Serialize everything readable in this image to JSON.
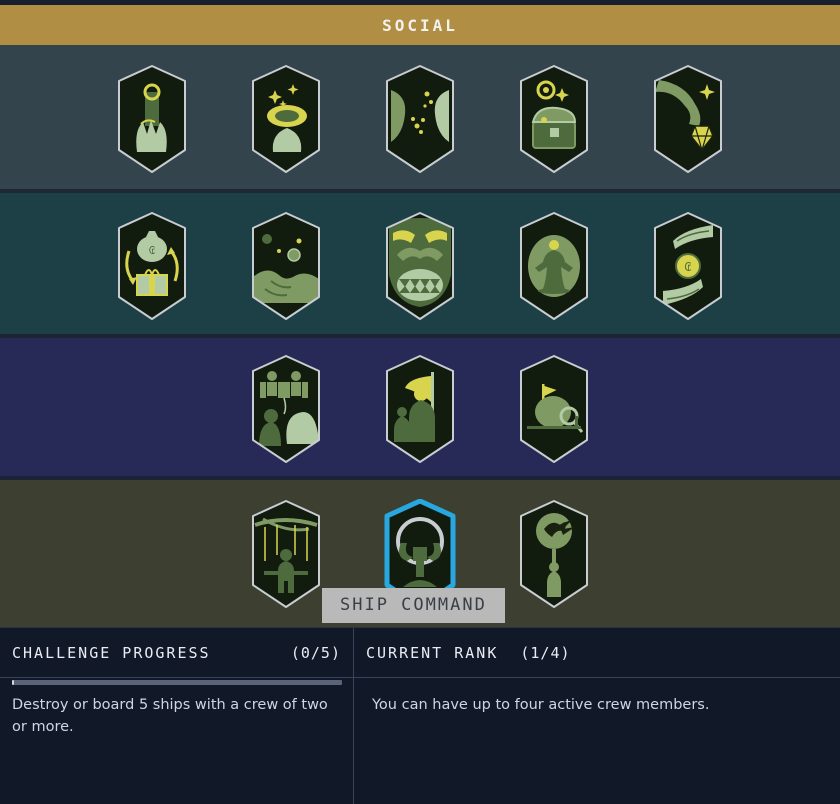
{
  "header": {
    "title": "SOCIAL"
  },
  "colors": {
    "header_bg": "#b08e44",
    "band1_bg": "#34444d",
    "band2_bg": "#1d3f46",
    "band3_bg": "#272a56",
    "band4_bg": "#3d4030",
    "badge_border": "#c9cdd2",
    "badge_fill": "#111b0e",
    "selected_border": "#29a8e0",
    "tooltip_bg": "#b9b9b9",
    "panel_bg": "#111828",
    "accent_green": "#7f9b63",
    "accent_yellow": "#d8d44e"
  },
  "rows": [
    {
      "name": "row-trade-fortune",
      "bg": "#34444d",
      "badges": [
        {
          "icon": "hand-holding-scroll-icon",
          "selected": false
        },
        {
          "icon": "hand-offering-artifact-icon",
          "selected": false
        },
        {
          "icon": "two-faces-talking-icon",
          "selected": false
        },
        {
          "icon": "open-treasure-chest-icon",
          "selected": false
        },
        {
          "icon": "hand-dangling-gem-icon",
          "selected": false
        }
      ]
    },
    {
      "name": "row-commerce",
      "bg": "#1d3f46",
      "badges": [
        {
          "icon": "money-bag-gift-exchange-icon",
          "selected": false
        },
        {
          "icon": "handshake-coins-icon",
          "selected": false
        },
        {
          "icon": "roaring-face-icon",
          "selected": false
        },
        {
          "icon": "standing-figure-oval-icon",
          "selected": false
        },
        {
          "icon": "two-hands-coin-icon",
          "selected": false
        }
      ]
    },
    {
      "name": "row-leadership",
      "bg": "#272a56",
      "badges": [
        {
          "icon": "crew-puppet-strings-icon",
          "selected": false
        },
        {
          "icon": "flag-bearer-squad-icon",
          "selected": false
        },
        {
          "icon": "planted-flag-hill-icon",
          "selected": false
        }
      ]
    },
    {
      "name": "row-command",
      "bg": "#3d4030",
      "badges": [
        {
          "icon": "marionette-control-icon",
          "selected": false
        },
        {
          "icon": "ship-command-halo-icon",
          "selected": true,
          "tooltip": "SHIP COMMAND"
        },
        {
          "icon": "bird-globe-figure-icon",
          "selected": false
        }
      ]
    }
  ],
  "tooltip": {
    "text": "SHIP COMMAND"
  },
  "info": {
    "challenge": {
      "label": "CHALLENGE PROGRESS",
      "count": "(0/5)",
      "progress_percent": 0,
      "description": "Destroy or board 5 ships with a crew of two or more."
    },
    "rank": {
      "label": "CURRENT RANK",
      "count": "(1/4)",
      "description": "You can have up to four active crew members."
    }
  }
}
